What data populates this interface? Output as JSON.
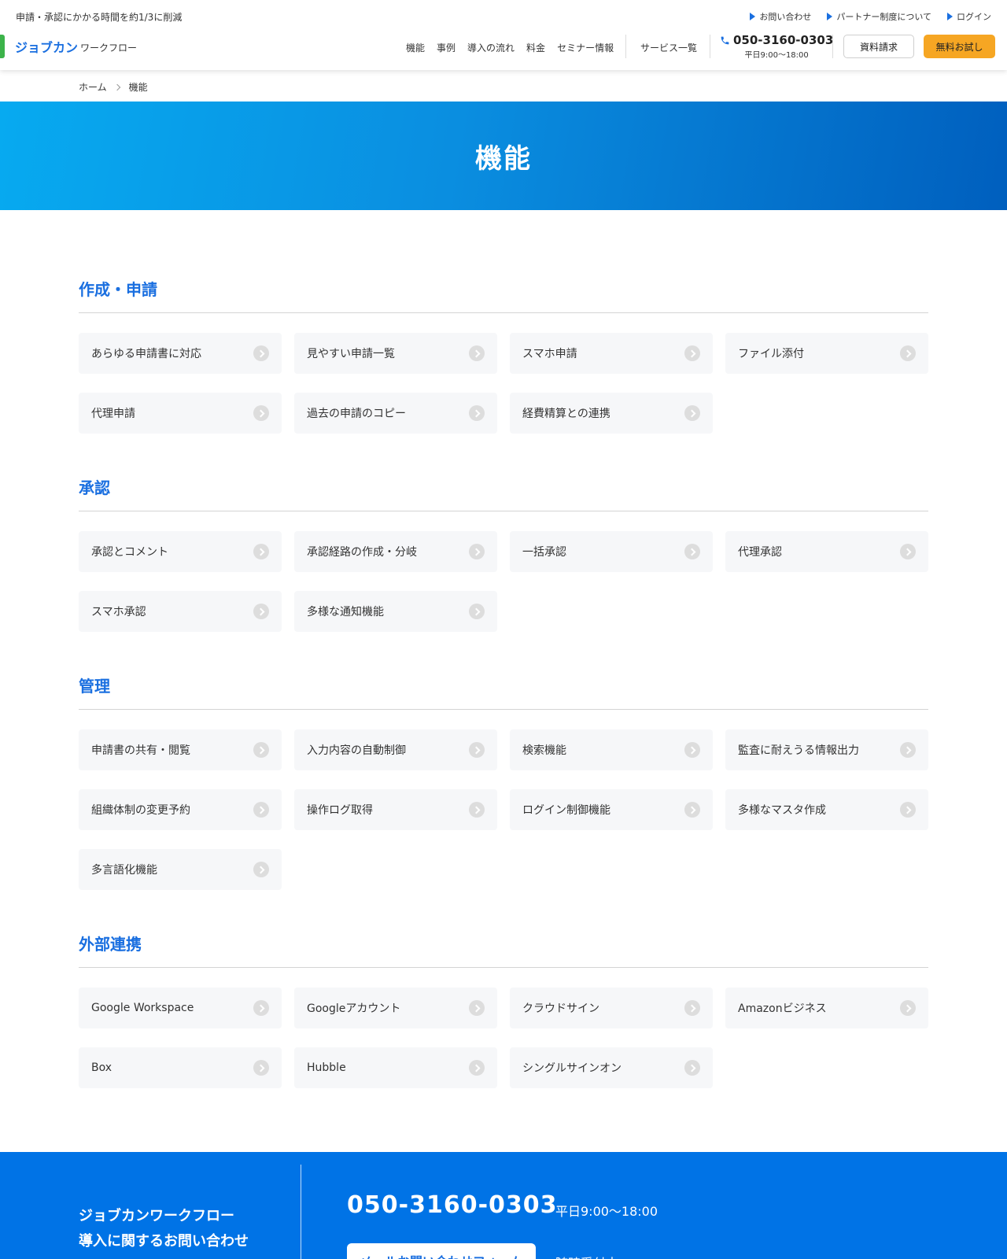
{
  "header": {
    "tagline": "申請・承認にかかる時間を約1/3に削減",
    "top_links": [
      {
        "label": "お問い合わせ"
      },
      {
        "label": "パートナー制度について"
      },
      {
        "label": "ログイン"
      }
    ],
    "logo_main": "ジョブカン",
    "logo_sub": "ワークフロー",
    "nav": [
      {
        "label": "機能"
      },
      {
        "label": "事例"
      },
      {
        "label": "導入の流れ"
      },
      {
        "label": "料金"
      },
      {
        "label": "セミナー情報"
      }
    ],
    "services_label": "サービス一覧",
    "phone": "050-3160-0303",
    "phone_hours": "平日9:00〜18:00",
    "request_button": "資料請求",
    "trial_button": "無料お試し",
    "colors": {
      "accent": "#1a6fe0",
      "trial": "#f6a623",
      "logo_bar": "#3cb34a"
    }
  },
  "breadcrumb": {
    "home": "ホーム",
    "current": "機能"
  },
  "hero": {
    "title": "機能"
  },
  "sections": [
    {
      "title": "作成・申請",
      "items": [
        "あらゆる申請書に対応",
        "見やすい申請一覧",
        "スマホ申請",
        "ファイル添付",
        "代理申請",
        "過去の申請のコピー",
        "経費精算との連携"
      ]
    },
    {
      "title": "承認",
      "items": [
        "承認とコメント",
        "承認経路の作成・分岐",
        "一括承認",
        "代理承認",
        "スマホ承認",
        "多様な通知機能"
      ]
    },
    {
      "title": "管理",
      "items": [
        "申請書の共有・閲覧",
        "入力内容の自動制御",
        "検索機能",
        "監査に耐えうる情報出力",
        "組織体制の変更予約",
        "操作ログ取得",
        "ログイン制御機能",
        "多様なマスタ作成",
        "多言語化機能"
      ]
    },
    {
      "title": "外部連携",
      "items": [
        "Google Workspace",
        "Googleアカウント",
        "クラウドサイン",
        "Amazonビジネス",
        "Box",
        "Hubble",
        "シングルサインオン"
      ]
    }
  ],
  "cta": {
    "heading_line1": "ジョブカンワークフロー",
    "heading_line2": "導入に関するお問い合わせ",
    "phone": "050-3160-0303",
    "hours": "平日9:00〜18:00",
    "form_button": "メールお問い合わせフォーム",
    "form_note": "随時受付中",
    "background": "#0073e6"
  }
}
